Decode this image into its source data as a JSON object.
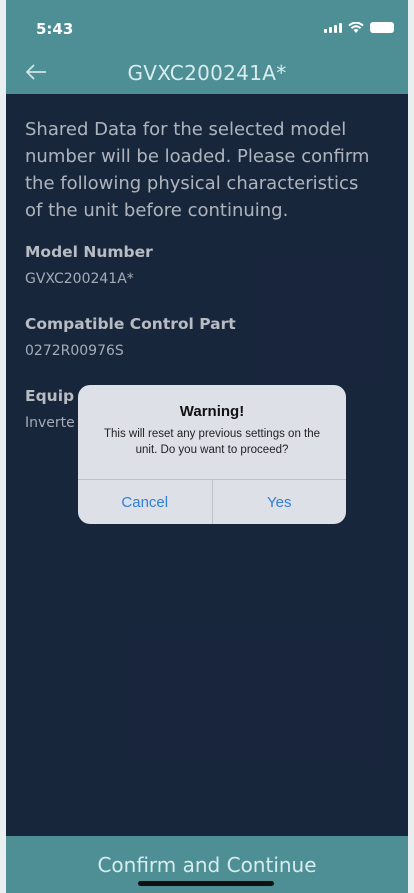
{
  "status_bar": {
    "time": "5:43"
  },
  "nav": {
    "title": "GVXC200241A*",
    "back_icon": "arrow-left-icon"
  },
  "content": {
    "intro": "Shared Data for the selected model number will be loaded. Please confirm the following physical characteristics of the unit before continuing.",
    "fields": [
      {
        "label": "Model Number",
        "value": "GVXC200241A*"
      },
      {
        "label": "Compatible Control Part",
        "value": "0272R00976S"
      },
      {
        "label": "Equip",
        "value": "Inverte"
      }
    ]
  },
  "dialog": {
    "title": "Warning!",
    "message": "This will reset any previous settings on the unit. Do you want to proceed?",
    "cancel_label": "Cancel",
    "yes_label": "Yes"
  },
  "footer": {
    "confirm_label": "Confirm and Continue"
  },
  "colors": {
    "header": "#4e8f96",
    "background": "#1d2c46",
    "dialog_button": "#2f7fd6"
  }
}
